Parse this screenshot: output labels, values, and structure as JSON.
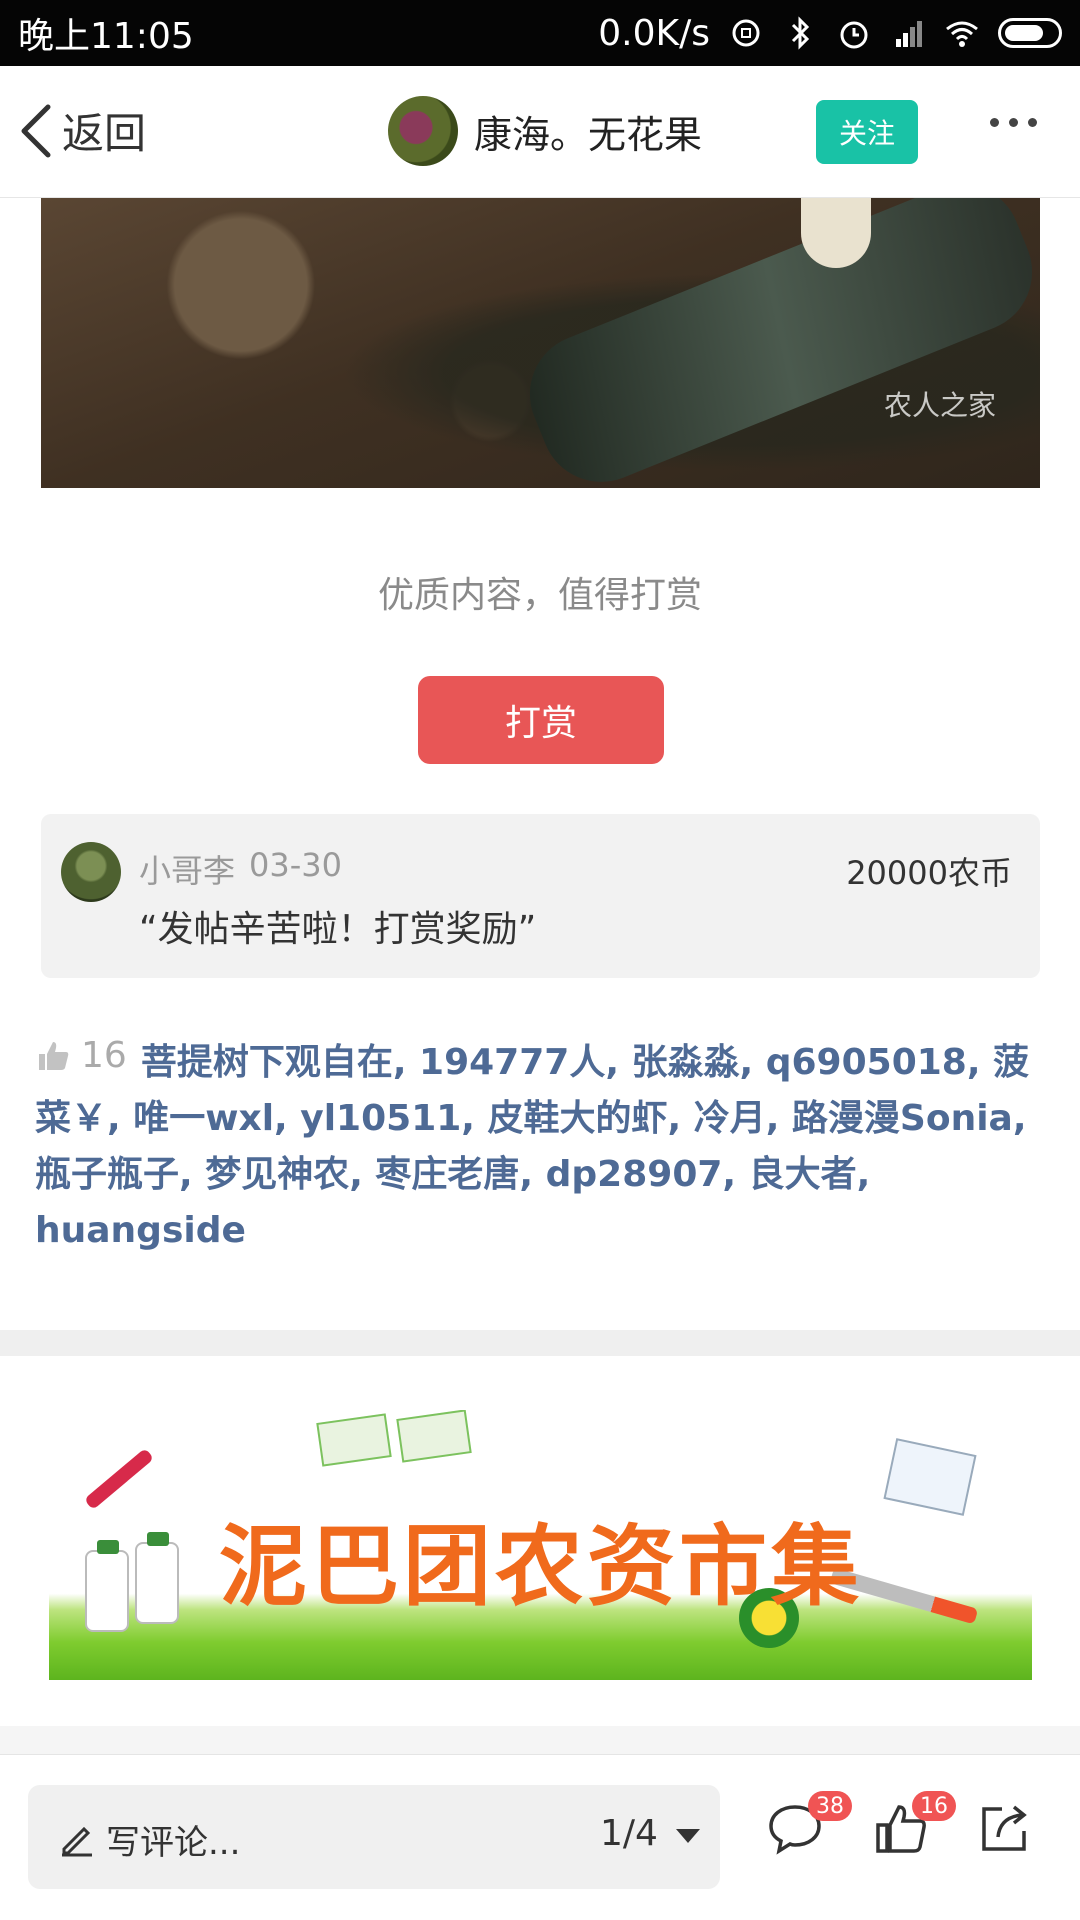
{
  "status_bar": {
    "time": "晚上11:05",
    "speed": "0.0K/s",
    "icons": [
      "sync-icon",
      "bluetooth-icon",
      "alarm-icon",
      "hd-signal-icon",
      "wifi-icon",
      "battery-icon"
    ]
  },
  "header": {
    "back_label": "返回",
    "author_name": "康海。无花果",
    "follow_label": "关注",
    "more_icon": "more-dots-icon"
  },
  "article": {
    "image_watermark": "农人之家"
  },
  "reward": {
    "prompt": "优质内容，值得打赏",
    "button_label": "打赏",
    "record": {
      "user": "小哥李",
      "date": "03-30",
      "amount": "20000农币",
      "message": "“发帖辛苦啦！打赏奖励”"
    }
  },
  "likes": {
    "count": "16",
    "names": "菩提树下观自在, 194777人, 张淼淼, q6905018, 菠菜￥, 唯一wxl, yl10511, 皮鞋大的虾, 冷月, 路漫漫Sonia, 瓶子瓶子, 梦见神农, 枣庄老唐, dp28907, 良大者, huangside"
  },
  "banner": {
    "title": "泥巴团农资市集"
  },
  "bottom_bar": {
    "comment_placeholder": "写评论...",
    "page_indicator": "1/4",
    "comment_count": "38",
    "like_count": "16"
  },
  "colors": {
    "follow": "#19c2a6",
    "reward_button": "#e85656",
    "like_names": "#4e6a95",
    "badge": "#f05454"
  }
}
